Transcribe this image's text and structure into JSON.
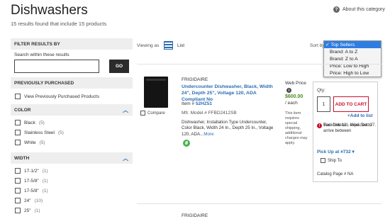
{
  "header": {
    "title": "Dishwashers",
    "results": "15 results found that include 15 products",
    "about_link": "About this category",
    "about_icon": "?"
  },
  "sidebar": {
    "filter_title": "FILTER RESULTS BY",
    "search_label": "Search within these results",
    "search_value": "",
    "go_label": "GO",
    "previously_purchased_title": "PREVIOUSLY PURCHASED",
    "previously_purchased_option": "View Previously Purchased Products",
    "color_title": "COLOR",
    "color_options": [
      {
        "label": "Black",
        "count": "(5)"
      },
      {
        "label": "Stainless Steel",
        "count": "(5)"
      },
      {
        "label": "White",
        "count": "(5)"
      }
    ],
    "width_title": "WIDTH",
    "width_options": [
      {
        "label": "17-1/2\"",
        "count": "(1)"
      },
      {
        "label": "17-5/8\"",
        "count": "(1)"
      },
      {
        "label": "17-5/8\"",
        "count": "(1)"
      },
      {
        "label": "24\"",
        "count": "(10)"
      },
      {
        "label": "25\"",
        "count": "(1)"
      }
    ]
  },
  "toolbar": {
    "viewing_as": "Viewing as",
    "list_label": "List",
    "sort_by": "Sort by",
    "sort_options": [
      "Top Sellers",
      "Brand: A to Z",
      "Brand: Z to A",
      "Price: Low to High",
      "Price: High to Low"
    ],
    "sort_selected_mark": "✓"
  },
  "product": {
    "compare": "Compare",
    "brand": "FRIGIDAIRE",
    "name": "Undercounter Dishwasher, Black, Width 24\", Depth 25\", Voltage 120, ADA Compliant No",
    "item_label": "Item #",
    "item_number": "52HZ51",
    "mfr": "Mfr. Model # FFBD2412SB",
    "description": "Dishwasher, Installation Type Undercounter, Color Black, Width 24 In., Depth 25 In., Voltage 120, ADA...",
    "more": "More",
    "web_price_label": "Web Price",
    "price": "$600.00",
    "each": "/ each",
    "ship_note": "This item requires special shipping, additional charges may apply.",
    "qty_label": "Qty:",
    "qty_value": "1",
    "add_to_cart": "ADD TO CART",
    "add_to_list": "+Add to list",
    "backorder_text": "Backordered, expected to arrive between",
    "backorder_dates": "Tue. Dec 12 - Wed. Dec 27.",
    "pickup": "Pick Up at #732 ▾",
    "ship_to": "Ship To",
    "catalog": "Catalog Page # NA"
  },
  "next_product": {
    "brand": "FRIGIDAIRE"
  },
  "colors": {
    "accent": "#2a6db3",
    "cart_red": "#c8102e",
    "price_green": "#4a8a1c",
    "select_blue": "#2f7de1"
  }
}
